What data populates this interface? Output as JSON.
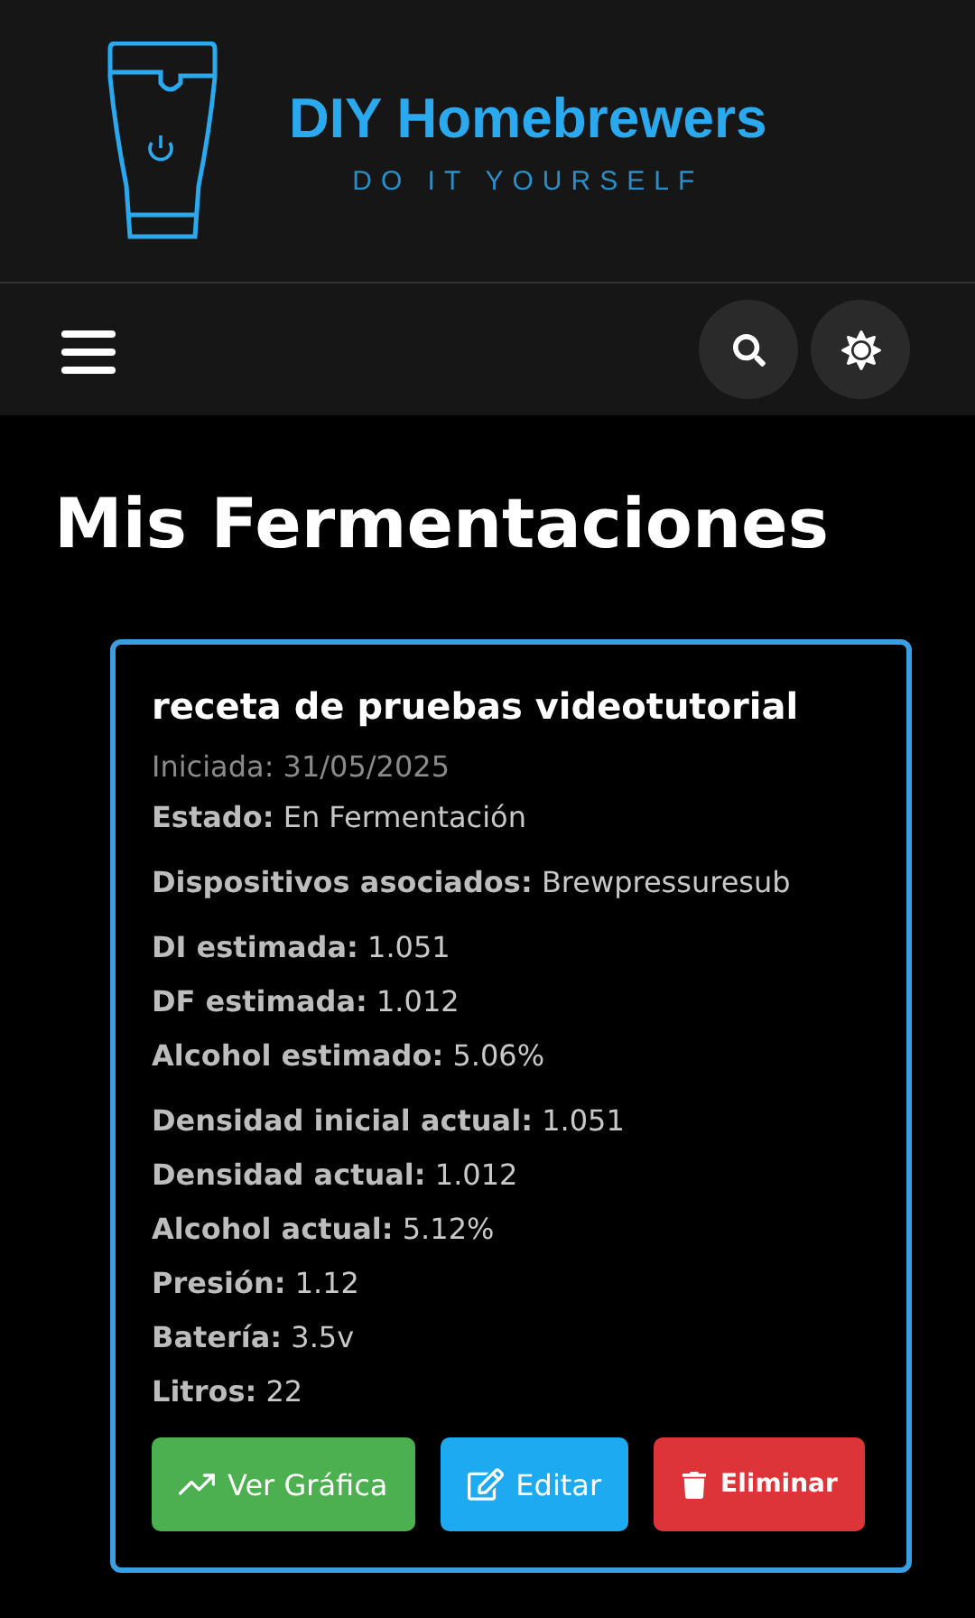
{
  "brand": {
    "name": "DIY Homebrewers",
    "tagline": "DO IT YOURSELF"
  },
  "nav": {
    "actions": [
      {
        "kind": "search"
      },
      {
        "kind": "theme"
      }
    ]
  },
  "page_title": "Mis Fermentaciones",
  "fermentations": [
    {
      "title": "receta de pruebas videotutorial",
      "started": "Iniciada: 31/05/2025",
      "field_groups": [
        [
          {
            "label": "Estado:",
            "value": "En Fermentación"
          }
        ],
        [
          {
            "label": "Dispositivos asociados:",
            "value": "Brewpressuresub"
          }
        ],
        [
          {
            "label": "DI estimada:",
            "value": "1.051"
          },
          {
            "label": "DF estimada:",
            "value": "1.012"
          },
          {
            "label": "Alcohol estimado:",
            "value": "5.06%"
          }
        ],
        [
          {
            "label": "Densidad inicial actual:",
            "value": "1.051"
          },
          {
            "label": "Densidad actual:",
            "value": "1.012"
          },
          {
            "label": "Alcohol actual:",
            "value": "5.12%"
          },
          {
            "label": "Presión:",
            "value": "1.12"
          },
          {
            "label": "Batería:",
            "value": "3.5v"
          },
          {
            "label": "Litros:",
            "value": "22"
          }
        ]
      ],
      "buttons": [
        {
          "kind": "chart",
          "label": "Ver Gráfica"
        },
        {
          "kind": "edit",
          "label": "Editar"
        },
        {
          "kind": "delete",
          "label": "Eliminar"
        }
      ]
    }
  ]
}
